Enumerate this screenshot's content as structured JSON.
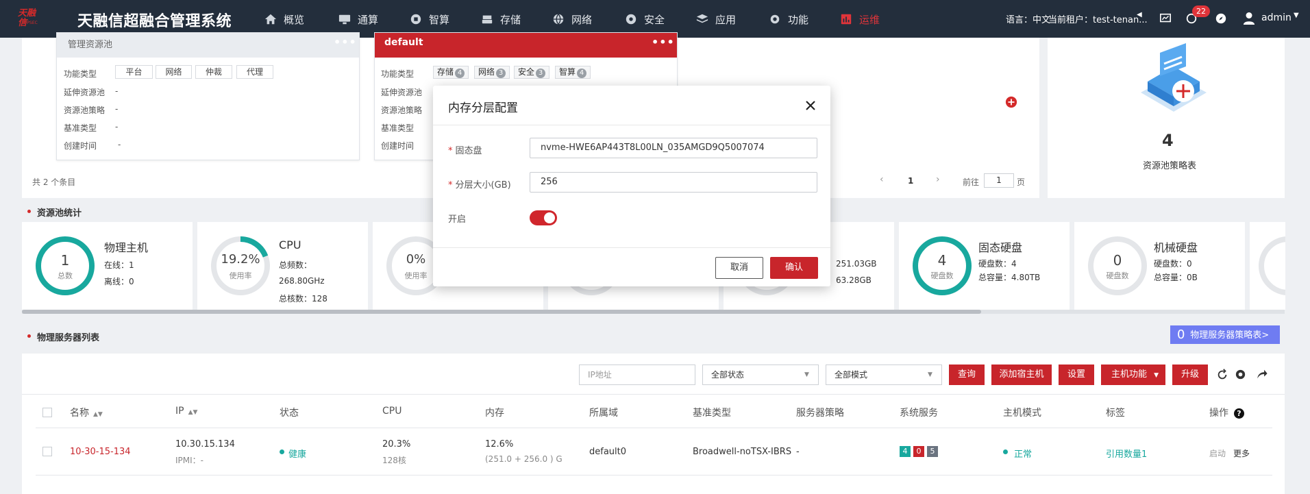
{
  "header": {
    "logo_text": "天融信",
    "logo_sub": "TOPSEC",
    "app_title": "天融信超融合管理系统",
    "nav": [
      {
        "label": "概览",
        "icon": "home-icon"
      },
      {
        "label": "通算",
        "icon": "monitor-icon"
      },
      {
        "label": "智算",
        "icon": "chip-icon"
      },
      {
        "label": "存储",
        "icon": "storage-icon"
      },
      {
        "label": "网络",
        "icon": "globe-icon"
      },
      {
        "label": "安全",
        "icon": "shield-gear-icon"
      },
      {
        "label": "应用",
        "icon": "layers-icon"
      },
      {
        "label": "功能",
        "icon": "gear-icon"
      },
      {
        "label": "运维",
        "icon": "bar-chart-icon"
      }
    ],
    "language": "语言：中文",
    "tenant": "当前租户：test-tenan...",
    "notification_count": "22",
    "user": "admin"
  },
  "pools": {
    "pool1": {
      "title": "管理资源池",
      "function_label": "功能类型",
      "tags": [
        "平台",
        "网络",
        "仲裁",
        "代理"
      ],
      "rows": [
        {
          "label": "延伸资源池",
          "value": "-"
        },
        {
          "label": "资源池策略",
          "value": "-"
        },
        {
          "label": "基准类型",
          "value": "-"
        },
        {
          "label": "创建时间",
          "value": "-"
        }
      ]
    },
    "pool2": {
      "title": "default",
      "function_label": "功能类型",
      "tags": [
        {
          "label": "存储",
          "count": "4"
        },
        {
          "label": "网络",
          "count": "3"
        },
        {
          "label": "安全",
          "count": "3"
        },
        {
          "label": "智算",
          "count": "4"
        }
      ],
      "rows": [
        {
          "label": "延伸资源池"
        },
        {
          "label": "资源池策略"
        },
        {
          "label": "基准类型"
        },
        {
          "label": "创建时间"
        }
      ]
    },
    "total": "共 2 个条目",
    "page": "1",
    "goto_label": "前往",
    "goto_value": "1",
    "page_unit": "页",
    "policy_count": "4",
    "policy_label": "资源池策略表"
  },
  "stats": {
    "section_title": "资源池统计",
    "host": {
      "title": "物理主机",
      "value": "1",
      "label": "总数",
      "online": "在线：1",
      "offline": "离线：0"
    },
    "cpu": {
      "title": "CPU",
      "value": "19.2%",
      "label": "使用率",
      "freq_label": "总频数：",
      "freq": "268.80GHz",
      "cores": "总核数：128",
      "usage_pct": 19.2
    },
    "mem": {
      "value": "0%",
      "label": "使用率"
    },
    "mem_total": "251.03GB",
    "mem_used": "63.28GB",
    "ssd": {
      "title": "固态硬盘",
      "value": "4",
      "label": "硬盘数",
      "count": "硬盘数：4",
      "capacity": "总容量：4.80TB"
    },
    "hdd": {
      "title": "机械硬盘",
      "value": "0",
      "label": "硬盘数",
      "count": "硬盘数：0",
      "capacity": "总容量：0B"
    }
  },
  "servers": {
    "section_title": "物理服务器列表",
    "policy_btn_count": "0",
    "policy_btn_label": "物理服务器策略表>",
    "ip_placeholder": "IP地址",
    "status_select": "全部状态",
    "mode_select": "全部模式",
    "buttons": {
      "query": "查询",
      "add_host": "添加宿主机",
      "settings": "设置",
      "host_func": "主机功能",
      "upgrade": "升级"
    },
    "columns": [
      "名称",
      "IP",
      "状态",
      "CPU",
      "内存",
      "所属域",
      "基准类型",
      "服务器策略",
      "系统服务",
      "主机模式",
      "标签",
      "操作"
    ],
    "rows": [
      {
        "name": "10-30-15-134",
        "ip": "10.30.15.134",
        "ipmi": "IPMI：-",
        "status": "健康",
        "cpu": "20.3%",
        "cpu_cores": "128核",
        "mem": "12.6%",
        "mem_detail": "(251.0 + 256.0 ) G",
        "domain": "default0",
        "baseline": "Broadwell-noTSX-IBRS",
        "policy": "-",
        "services": [
          "4",
          "0",
          "5"
        ],
        "host_mode": "正常",
        "tag": "引用数量1",
        "action_start": "启动",
        "action_more": "更多"
      }
    ]
  },
  "modal": {
    "title": "内存分层配置",
    "ssd_label": "固态盘",
    "ssd_value": "nvme-HWE6AP443T8L00LN_035AMGD9Q5007074",
    "size_label": "分层大小(GB)",
    "size_value": "256",
    "enable_label": "开启",
    "enabled": true,
    "cancel": "取消",
    "confirm": "确认"
  },
  "colors": {
    "nav_bg": "#232e3c",
    "accent_red": "#c8252b",
    "teal": "#18a89e",
    "policy_btn": "#6f7cf2"
  }
}
